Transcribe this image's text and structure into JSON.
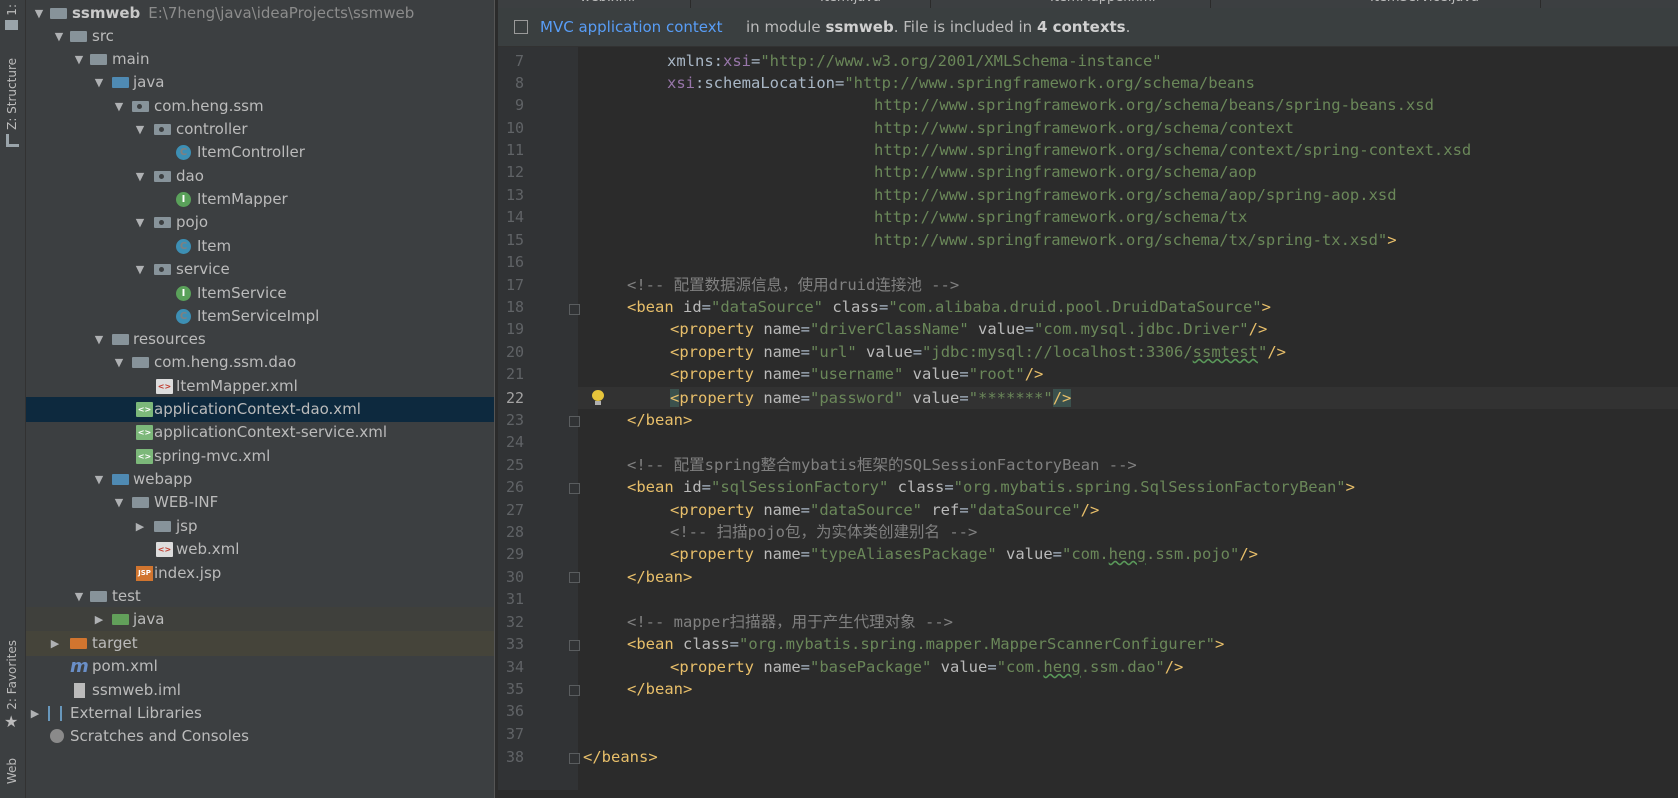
{
  "left_strip": {
    "project_tab": "1:",
    "structure_tab": "Z: Structure",
    "favorites_tab": "2: Favorites",
    "web_tab": "Web"
  },
  "project_tree": {
    "root_name": "ssmweb",
    "root_path": "E:\\7heng\\java\\ideaProjects\\ssmweb",
    "items": [
      {
        "label": "src"
      },
      {
        "label": "main"
      },
      {
        "label": "java"
      },
      {
        "label": "com.heng.ssm"
      },
      {
        "label": "controller"
      },
      {
        "label": "ItemController"
      },
      {
        "label": "dao"
      },
      {
        "label": "ItemMapper"
      },
      {
        "label": "pojo"
      },
      {
        "label": "Item"
      },
      {
        "label": "service"
      },
      {
        "label": "ItemService"
      },
      {
        "label": "ItemServiceImpl"
      },
      {
        "label": "resources"
      },
      {
        "label": "com.heng.ssm.dao"
      },
      {
        "label": "ItemMapper.xml"
      },
      {
        "label": "applicationContext-dao.xml"
      },
      {
        "label": "applicationContext-service.xml"
      },
      {
        "label": "spring-mvc.xml"
      },
      {
        "label": "webapp"
      },
      {
        "label": "WEB-INF"
      },
      {
        "label": "jsp"
      },
      {
        "label": "web.xml"
      },
      {
        "label": "index.jsp"
      },
      {
        "label": "test"
      },
      {
        "label": "java"
      },
      {
        "label": "target"
      },
      {
        "label": "pom.xml"
      },
      {
        "label": "ssmweb.iml"
      },
      {
        "label": "External Libraries"
      },
      {
        "label": "Scratches and Consoles"
      }
    ],
    "selected": "applicationContext-dao.xml"
  },
  "editor": {
    "tabs": [
      "web.xml",
      "Item.java",
      "ItemMapper.xml",
      "ItemService.java"
    ],
    "banner": {
      "link": "MVC application context",
      "info_prefix": "in module ",
      "module": "ssmweb",
      "info_mid": ". File is included in ",
      "contexts": "4 contexts",
      "info_suffix": "."
    },
    "current_line": 22,
    "line_numbers": [
      "7",
      "8",
      "9",
      "10",
      "11",
      "12",
      "13",
      "14",
      "15",
      "16",
      "17",
      "18",
      "19",
      "20",
      "21",
      "22",
      "23",
      "24",
      "25",
      "26",
      "27",
      "28",
      "29",
      "30",
      "31",
      "32",
      "33",
      "34",
      "35",
      "36",
      "37",
      "38"
    ],
    "code": {
      "l7": {
        "ns": "xmlns:",
        "nsk": "xsi",
        "eq": "=",
        "val": "\"http://www.w3.org/2001/XMLSchema-instance\""
      },
      "l8": {
        "ns": "xsi",
        "attr": ":schemaLocation",
        "eq": "=",
        "val": "\"http://www.springframework.org/schema/beans"
      },
      "l9": "http://www.springframework.org/schema/beans/spring-beans.xsd",
      "l10": "http://www.springframework.org/schema/context",
      "l11": "http://www.springframework.org/schema/context/spring-context.xsd",
      "l12": "http://www.springframework.org/schema/aop",
      "l13": "http://www.springframework.org/schema/aop/spring-aop.xsd",
      "l14": "http://www.springframework.org/schema/tx",
      "l15": "http://www.springframework.org/schema/tx/spring-tx.xsd\"",
      "l15_end": ">",
      "l17": "<!-- 配置数据源信息，使用druid连接池 -->",
      "l18": {
        "tag": "<bean",
        "a1": " id",
        "v1": "\"dataSource\"",
        "a2": " class",
        "v2": "\"com.alibaba.druid.pool.DruidDataSource\"",
        "end": ">"
      },
      "l19": {
        "tag": "<property",
        "a1": " name",
        "v1": "\"driverClassName\"",
        "a2": " value",
        "v2": "\"com.mysql.jdbc.Driver\"",
        "end": "/>"
      },
      "l20": {
        "tag": "<property",
        "a1": " name",
        "v1": "\"url\"",
        "a2": " value",
        "v2a": "\"jdbc:mysql://localhost:3306/",
        "v2b": "ssmtest",
        "v2c": "\"",
        "end": "/>"
      },
      "l21": {
        "tag": "<property",
        "a1": " name",
        "v1": "\"username\"",
        "a2": " value",
        "v2": "\"root\"",
        "end": "/>"
      },
      "l22": {
        "tag1": "<",
        "tag2": "property",
        "a1": " name",
        "v1": "\"password\"",
        "a2": " value",
        "v2": "\"*******\"",
        "end": "/>"
      },
      "l23": "</bean>",
      "l25": "<!-- 配置spring整合mybatis框架的SQLSessionFactoryBean -->",
      "l26": {
        "tag": "<bean",
        "a1": " id",
        "v1": "\"sqlSessionFactory\"",
        "a2": " class",
        "v2": "\"org.mybatis.spring.SqlSessionFactoryBean\"",
        "end": ">"
      },
      "l27": {
        "tag": "<property",
        "a1": " name",
        "v1": "\"dataSource\"",
        "a2": " ref",
        "v2": "\"dataSource\"",
        "end": "/>"
      },
      "l28": "<!-- 扫描pojo包，为实体类创建别名 -->",
      "l29": {
        "tag": "<property",
        "a1": " name",
        "v1": "\"typeAliasesPackage\"",
        "a2": " value",
        "v2a": "\"com.",
        "v2b": "heng",
        "v2c": ".ssm.pojo\"",
        "end": "/>"
      },
      "l30": "</bean>",
      "l32": "<!-- mapper扫描器，用于产生代理对象 -->",
      "l33": {
        "tag": "<bean",
        "a1": " class",
        "v1": "\"org.mybatis.spring.mapper.MapperScannerConfigurer\"",
        "end": ">"
      },
      "l34": {
        "tag": "<property",
        "a1": " name",
        "v1": "\"basePackage\"",
        "a2": " value",
        "v2a": "\"com.",
        "v2b": "heng",
        "v2c": ".ssm.dao\"",
        "end": "/>"
      },
      "l35": "</bean>",
      "l38": "</beans>"
    }
  }
}
